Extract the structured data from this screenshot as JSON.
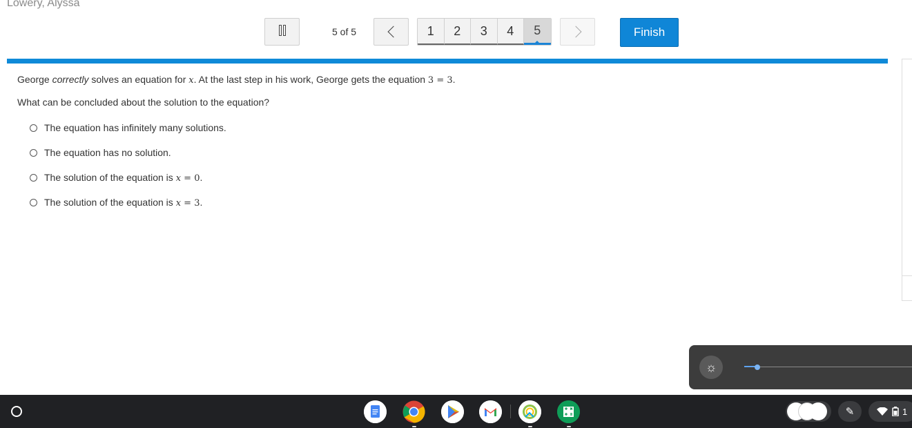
{
  "user": {
    "name": "Lowery, Alyssa"
  },
  "nav": {
    "counter": "5 of 5",
    "pages": [
      "1",
      "2",
      "3",
      "4",
      "5"
    ],
    "current_page": "5",
    "finish_label": "Finish"
  },
  "question": {
    "text_1": "George ",
    "text_emphasis": "correctly",
    "text_2": "  solves an equation for ",
    "var_x": "x",
    "text_3": ". At the last step in his work, George gets the equation ",
    "equation": "3 = 3",
    "text_4": ".",
    "prompt": "What can be concluded about the solution to the equation?"
  },
  "options": [
    {
      "label": "The equation has infinitely many solutions.",
      "math": "",
      "suffix": ""
    },
    {
      "label": "The equation has no solution.",
      "math": "",
      "suffix": ""
    },
    {
      "label": "The solution of the equation is ",
      "math_var": "x",
      "math_rest": " = 0",
      "suffix": "."
    },
    {
      "label": "The solution of the equation is ",
      "math_var": "x",
      "math_rest": " = 3",
      "suffix": "."
    }
  ],
  "brightness": {
    "level": 0.06
  },
  "taskbar": {
    "apps": [
      {
        "name": "Google Docs",
        "icon": "docs-icon",
        "color": "#4285f4"
      },
      {
        "name": "Chrome",
        "icon": "chrome-icon",
        "color": "#db4437"
      },
      {
        "name": "Play Store",
        "icon": "play-store-icon",
        "color": "#34a853"
      },
      {
        "name": "Gmail",
        "icon": "gmail-icon",
        "color": "#ffffff"
      },
      {
        "name": "Photos",
        "icon": "photos-icon",
        "color": "#ffffff"
      },
      {
        "name": "Sheets-like app",
        "icon": "calculator-app-icon",
        "color": "#0f9d58"
      }
    ],
    "tray_text": "1"
  },
  "colors": {
    "accent": "#0f86d7",
    "taskbar": "#202124"
  }
}
